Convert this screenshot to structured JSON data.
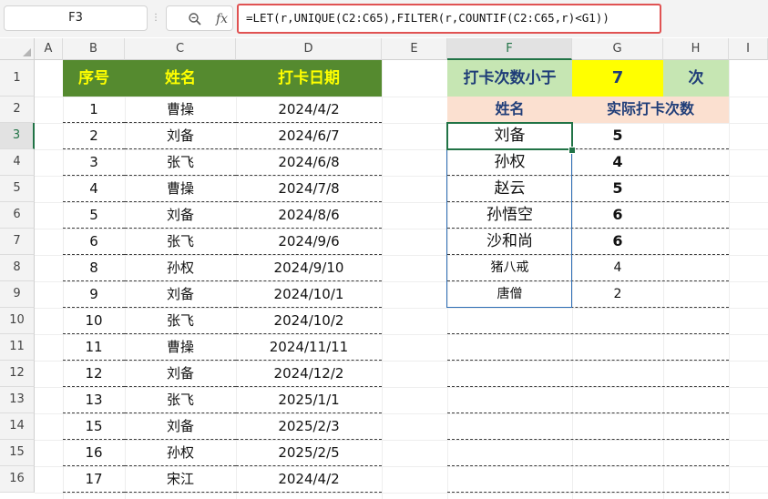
{
  "formula_bar": {
    "name_box": "F3",
    "zoom_icon": "magnifier-icon",
    "fx_label": "fx",
    "formula": "=LET(r,UNIQUE(C2:C65),FILTER(r,COUNTIF(C2:C65,r)<G1))"
  },
  "columns": [
    "A",
    "B",
    "C",
    "D",
    "E",
    "F",
    "G",
    "H",
    "I"
  ],
  "rows": [
    "1",
    "2",
    "3",
    "4",
    "5",
    "6",
    "7",
    "8",
    "9",
    "10",
    "11",
    "12",
    "13",
    "14",
    "15",
    "16"
  ],
  "header_row": {
    "seq": "序号",
    "name": "姓名",
    "date": "打卡日期"
  },
  "records": [
    {
      "seq": "1",
      "name": "曹操",
      "date": "2024/4/2"
    },
    {
      "seq": "2",
      "name": "刘备",
      "date": "2024/6/7"
    },
    {
      "seq": "3",
      "name": "张飞",
      "date": "2024/6/8"
    },
    {
      "seq": "4",
      "name": "曹操",
      "date": "2024/7/8"
    },
    {
      "seq": "5",
      "name": "刘备",
      "date": "2024/8/6"
    },
    {
      "seq": "6",
      "name": "张飞",
      "date": "2024/9/6"
    },
    {
      "seq": "8",
      "name": "孙权",
      "date": "2024/9/10"
    },
    {
      "seq": "9",
      "name": "刘备",
      "date": "2024/10/1"
    },
    {
      "seq": "10",
      "name": "张飞",
      "date": "2024/10/2"
    },
    {
      "seq": "11",
      "name": "曹操",
      "date": "2024/11/11"
    },
    {
      "seq": "12",
      "name": "刘备",
      "date": "2024/12/2"
    },
    {
      "seq": "13",
      "name": "张飞",
      "date": "2025/1/1"
    },
    {
      "seq": "15",
      "name": "刘备",
      "date": "2025/2/3"
    },
    {
      "seq": "16",
      "name": "孙权",
      "date": "2025/2/5"
    },
    {
      "seq": "17",
      "name": "宋江",
      "date": "2024/4/2"
    }
  ],
  "criteria": {
    "label": "打卡次数小于",
    "value": "7",
    "unit": "次"
  },
  "result_header": {
    "name": "姓名",
    "count": "实际打卡次数"
  },
  "results": [
    {
      "name": "刘备",
      "count": "5"
    },
    {
      "name": "孙权",
      "count": "4"
    },
    {
      "name": "赵云",
      "count": "5"
    },
    {
      "name": "孙悟空",
      "count": "6"
    },
    {
      "name": "沙和尚",
      "count": "6"
    },
    {
      "name": "猪八戒",
      "count": "4"
    },
    {
      "name": "唐僧",
      "count": "2"
    }
  ],
  "colors": {
    "header_green": "#558a2f",
    "header_text_yellow": "#ffff00",
    "criteria_green": "#c6e6b3",
    "criteria_yellow": "#ffff00",
    "result_header_peach": "#fbe0d0",
    "selection_green": "#217346",
    "formula_highlight_red": "#e05252"
  }
}
